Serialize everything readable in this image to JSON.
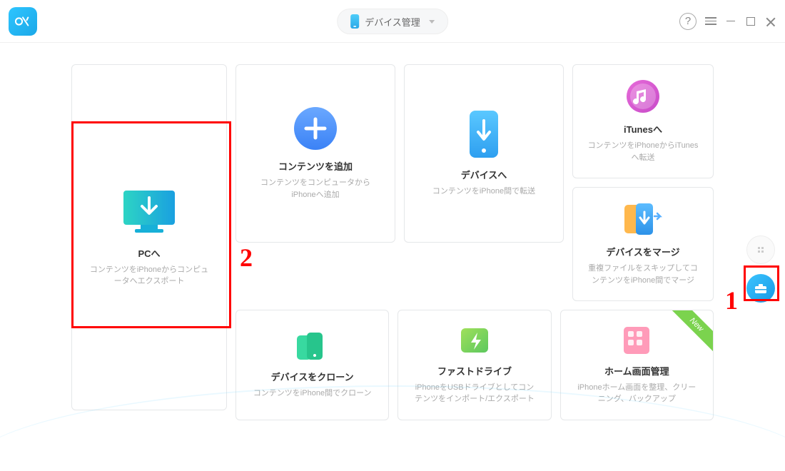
{
  "header": {
    "device_label": "デバイス管理",
    "help": "?"
  },
  "cards": {
    "pc": {
      "title": "PCへ",
      "desc": "コンテンツをiPhoneからコンピュータへエクスポート"
    },
    "add": {
      "title": "コンテンツを追加",
      "desc": "コンテンツをコンピュータからiPhoneへ追加"
    },
    "device": {
      "title": "デバイスへ",
      "desc": "コンテンツをiPhone間で転送"
    },
    "itunes": {
      "title": "iTunesへ",
      "desc": "コンテンツをiPhoneからiTunesへ転送"
    },
    "merge": {
      "title": "デバイスをマージ",
      "desc": "重複ファイルをスキップしてコンテンツをiPhone間でマージ"
    },
    "clone": {
      "title": "デバイスをクローン",
      "desc": "コンテンツをiPhone間でクローン"
    },
    "fast": {
      "title": "ファストドライブ",
      "desc": "iPhoneをUSBドライブとしてコンテンツをインポート/エクスポート"
    },
    "home": {
      "title": "ホーム画面管理",
      "desc": "iPhoneホーム画面を整理、クリーニング、バックアップ",
      "badge": "New"
    }
  },
  "annotations": {
    "one": "1",
    "two": "2"
  }
}
